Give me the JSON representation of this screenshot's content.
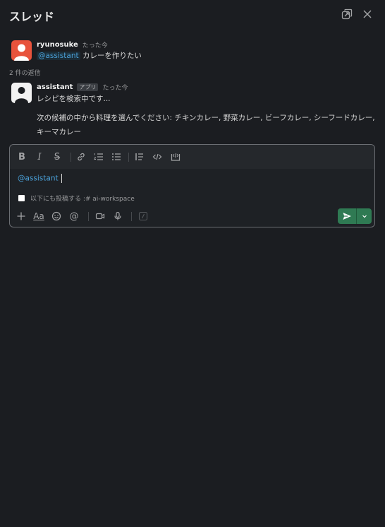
{
  "header": {
    "title": "スレッド",
    "popout_icon": "popout-icon",
    "close_icon": "close-icon"
  },
  "messages": [
    {
      "author": "ryunosuke",
      "time": "たった今",
      "mention": "@assistant",
      "text": "カレーを作りたい",
      "avatar_color": "#e8533c"
    }
  ],
  "reply_count": "2 件の返信",
  "replies": [
    {
      "author": "assistant",
      "badge": "アプリ",
      "time": "たった今",
      "lines": [
        "レシピを検索中です...",
        "次の候補の中から料理を選んでください: チキンカレー, 野菜カレー, ビーフカレー, シーフードカレー, キーマカレー"
      ]
    }
  ],
  "composer": {
    "value": "@assistant",
    "also_send_label": "以下にも投稿する :# ai-workspace",
    "format_icons": [
      "bold-icon",
      "italic-icon",
      "strikethrough-icon",
      "link-icon",
      "ordered-list-icon",
      "bullet-list-icon",
      "blockquote-icon",
      "code-icon",
      "code-block-icon"
    ],
    "action_icons": [
      "plus-icon",
      "text-format-icon",
      "emoji-icon",
      "mention-icon",
      "video-icon",
      "microphone-icon",
      "slash-command-icon"
    ],
    "send_color": "#2f7a53"
  },
  "colors": {
    "background": "#1b1d21",
    "mention": "#4aa0d8",
    "accent_green": "#2f7a53"
  }
}
